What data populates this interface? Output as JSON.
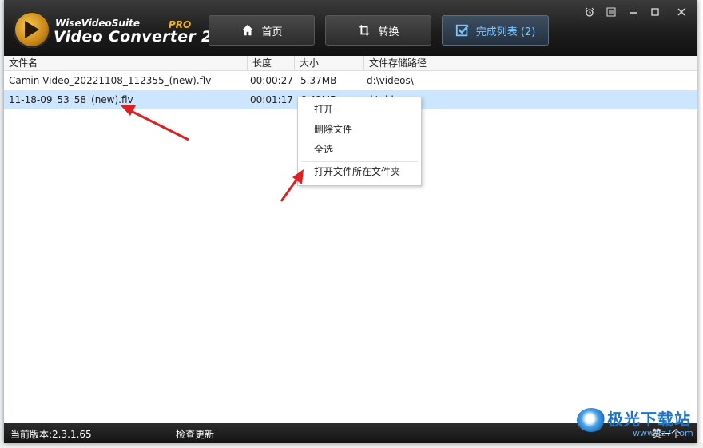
{
  "app": {
    "brand_small": "WiseVideoSuite",
    "brand_big": "Video Converter 2",
    "brand_pro": "PRO"
  },
  "nav": {
    "home": "首页",
    "convert": "转换",
    "completed": "完成列表 (2)"
  },
  "table": {
    "headers": [
      "文件名",
      "长度",
      "大小",
      "文件存储路径"
    ],
    "rows": [
      {
        "name": "Camin Video_20221108_112355_(new).flv",
        "length": "00:00:27",
        "size": "5.37MB",
        "path": "d:\\videos\\"
      },
      {
        "name": "11-18-09_53_58_(new).flv",
        "length": "00:01:17",
        "size": "6.41MB",
        "path": "d:\\videos\\"
      }
    ]
  },
  "context_menu": {
    "open": "打开",
    "delete": "删除文件",
    "select_all": "全选",
    "open_folder": "打开文件所在文件夹"
  },
  "status": {
    "version": "当前版本:2.3.1.65",
    "check_update": "检查更新",
    "next": "赞一个"
  },
  "watermark": {
    "name": "极光下载站",
    "url": "www.xz7.com"
  },
  "colors": {
    "selected_row": "#cce6ff",
    "annotation_arrow": "#e02020",
    "brand_accent": "#f0b62a"
  }
}
